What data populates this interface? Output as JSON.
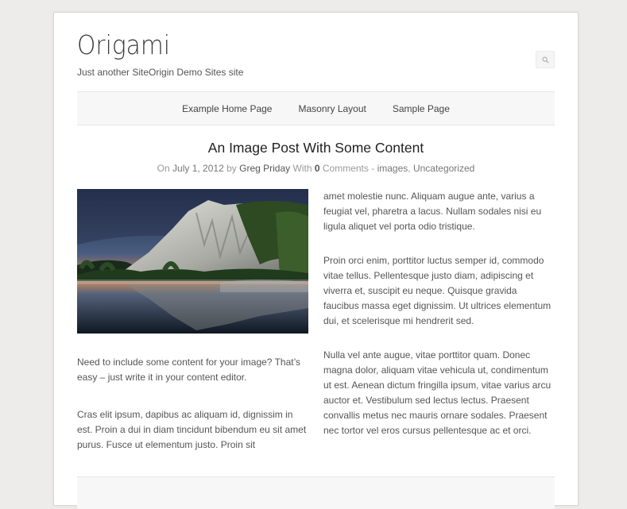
{
  "site": {
    "title": "Origami",
    "description": "Just another SiteOrigin Demo Sites site"
  },
  "search": {
    "icon": "search-icon"
  },
  "nav": {
    "items": [
      {
        "label": "Example Home Page"
      },
      {
        "label": "Masonry Layout"
      },
      {
        "label": "Sample Page"
      }
    ]
  },
  "post": {
    "title": "An Image Post With Some Content",
    "meta": {
      "on_label": "On",
      "date": "July 1, 2012",
      "by_label": "by",
      "author": "Greg Priday",
      "with_label": "With",
      "comment_count": "0",
      "comments_label": "Comments -",
      "category_1": "images",
      "separator": ",",
      "category_2": "Uncategorized"
    },
    "left_paragraphs": [
      "Need to include some content for your image? That’s easy – just write it in your content editor.",
      "Cras elit ipsum, dapibus ac aliquam id, dignissim in est. Proin a dui in diam tincidunt bibendum eu sit amet purus. Fusce ut elementum justo. Proin sit"
    ],
    "right_paragraphs": [
      "amet molestie nunc. Aliquam augue ante, varius a feugiat vel, pharetra a lacus. Nullam sodales nisi eu ligula aliquet vel porta odio tristique.",
      "Proin orci enim, porttitor luctus semper id, commodo vitae tellus. Pellentesque justo diam, adipiscing et viverra et, suscipit eu neque. Quisque gravida faucibus massa eget dignissim. Ut ultrices elementum dui, et scelerisque mi hendrerit sed.",
      "Nulla vel ante augue, vitae porttitor quam. Donec magna dolor, aliquam vitae vehicula ut, condimentum ut est. Aenean dictum fringilla ipsum, vitae varius arcu auctor et. Vestibulum sed lectus lectus. Praesent convallis metus nec mauris ornare sodales. Praesent nec tortor vel eros cursus pellentesque ac et orci."
    ]
  },
  "colors": {
    "background": "#edecea",
    "page": "#ffffff",
    "nav_bg": "#f7f7f7",
    "text": "#555555",
    "title": "#222222",
    "meta": "#999999"
  }
}
